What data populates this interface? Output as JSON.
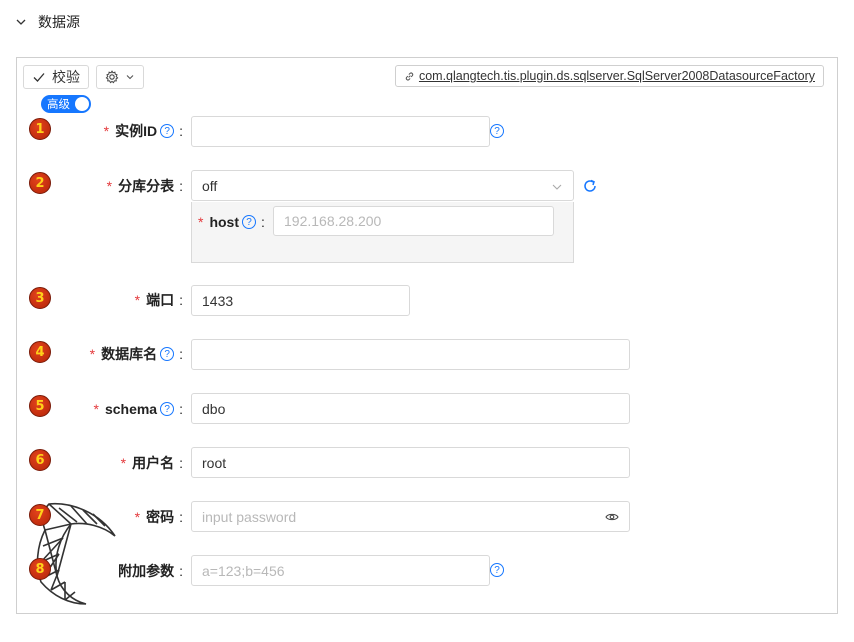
{
  "section": {
    "title": "数据源"
  },
  "toolbar": {
    "verify_label": "校验",
    "factory_class": "com.qlangtech.tis.plugin.ds.sqlserver.SqlServer2008DatasourceFactory"
  },
  "advanced_toggle": {
    "label": "高级",
    "on": true
  },
  "fields": [
    {
      "badge": "1",
      "label": "实例ID",
      "required": true,
      "help": true,
      "value": "",
      "placeholder": "",
      "help_after": true
    },
    {
      "badge": "2",
      "label": "分库分表",
      "required": true,
      "help": false,
      "value": "off",
      "type": "select",
      "refresh_icon": true
    },
    {
      "badge": "3",
      "label": "端口",
      "required": true,
      "help": false,
      "value": "1433",
      "placeholder": ""
    },
    {
      "badge": "4",
      "label": "数据库名",
      "required": true,
      "help": true,
      "value": "",
      "placeholder": ""
    },
    {
      "badge": "5",
      "label": "schema",
      "required": true,
      "help": true,
      "value": "dbo",
      "placeholder": ""
    },
    {
      "badge": "6",
      "label": "用户名",
      "required": true,
      "help": false,
      "value": "root",
      "placeholder": ""
    },
    {
      "badge": "7",
      "label": "密码",
      "required": true,
      "help": false,
      "value": "",
      "placeholder": "input password",
      "type": "password"
    },
    {
      "badge": "8",
      "label": "附加参数",
      "required": false,
      "help": false,
      "value": "",
      "placeholder": "a=123;b=456",
      "help_after": true
    }
  ],
  "host_field": {
    "label": "host",
    "required": true,
    "help": true,
    "value": "",
    "placeholder": "192.168.28.200"
  },
  "colors": {
    "accent": "#1677ff",
    "required": "#e4393c",
    "badge": "#c8300e",
    "badge_text": "#ffd21a"
  },
  "icons": [
    "chevron-down-icon",
    "check-icon",
    "gear-icon",
    "link-icon",
    "help-icon",
    "refresh-icon",
    "eye-icon",
    "sql-server-logo"
  ]
}
